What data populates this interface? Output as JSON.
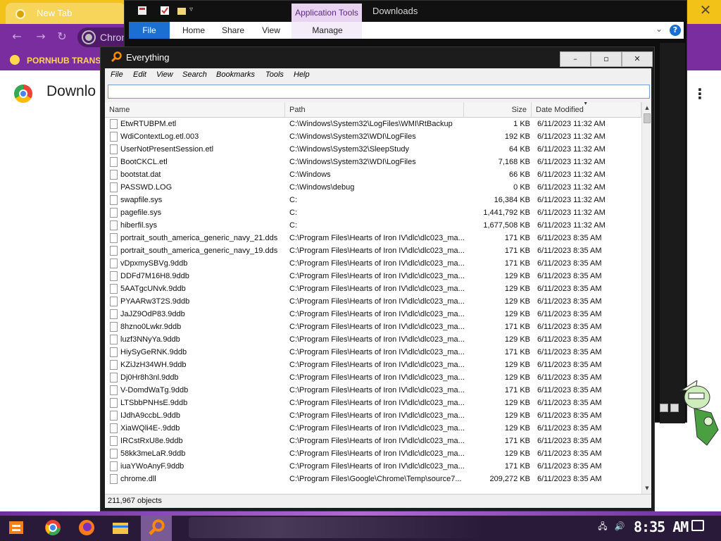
{
  "chrome": {
    "tab_title": "New Tab",
    "omnibox_text": "Chron",
    "bookmark_label": "PORNHUB TRANS",
    "page_title": "Downlo"
  },
  "explorer": {
    "context_tab": "Application Tools",
    "title": "Downloads",
    "ribbon_tabs": [
      "File",
      "Home",
      "Share",
      "View"
    ],
    "manage_tab": "Manage",
    "help_label": "?"
  },
  "everything": {
    "title": "Everything",
    "menu": [
      "File",
      "Edit",
      "View",
      "Search",
      "Bookmarks",
      "Tools",
      "Help"
    ],
    "search_value": "",
    "columns": {
      "name": "Name",
      "path": "Path",
      "size": "Size",
      "date": "Date Modified"
    },
    "rows": [
      {
        "name": "EtwRTUBPM.etl",
        "path": "C:\\Windows\\System32\\LogFiles\\WMI\\RtBackup",
        "size": "1 KB",
        "date": "6/11/2023 11:32 AM"
      },
      {
        "name": "WdiContextLog.etl.003",
        "path": "C:\\Windows\\System32\\WDI\\LogFiles",
        "size": "192 KB",
        "date": "6/11/2023 11:32 AM"
      },
      {
        "name": "UserNotPresentSession.etl",
        "path": "C:\\Windows\\System32\\SleepStudy",
        "size": "64 KB",
        "date": "6/11/2023 11:32 AM"
      },
      {
        "name": "BootCKCL.etl",
        "path": "C:\\Windows\\System32\\WDI\\LogFiles",
        "size": "7,168 KB",
        "date": "6/11/2023 11:32 AM"
      },
      {
        "name": "bootstat.dat",
        "path": "C:\\Windows",
        "size": "66 KB",
        "date": "6/11/2023 11:32 AM"
      },
      {
        "name": "PASSWD.LOG",
        "path": "C:\\Windows\\debug",
        "size": "0 KB",
        "date": "6/11/2023 11:32 AM"
      },
      {
        "name": "swapfile.sys",
        "path": "C:",
        "size": "16,384 KB",
        "date": "6/11/2023 11:32 AM"
      },
      {
        "name": "pagefile.sys",
        "path": "C:",
        "size": "1,441,792 KB",
        "date": "6/11/2023 11:32 AM"
      },
      {
        "name": "hiberfil.sys",
        "path": "C:",
        "size": "1,677,508 KB",
        "date": "6/11/2023 11:32 AM"
      },
      {
        "name": "portrait_south_america_generic_navy_21.dds",
        "path": "C:\\Program Files\\Hearts of Iron IV\\dlc\\dlc023_ma...",
        "size": "171 KB",
        "date": "6/11/2023 8:35 AM"
      },
      {
        "name": "portrait_south_america_generic_navy_19.dds",
        "path": "C:\\Program Files\\Hearts of Iron IV\\dlc\\dlc023_ma...",
        "size": "171 KB",
        "date": "6/11/2023 8:35 AM"
      },
      {
        "name": "vDpxmySBVg.9ddb",
        "path": "C:\\Program Files\\Hearts of Iron IV\\dlc\\dlc023_ma...",
        "size": "171 KB",
        "date": "6/11/2023 8:35 AM"
      },
      {
        "name": "DDFd7M16H8.9ddb",
        "path": "C:\\Program Files\\Hearts of Iron IV\\dlc\\dlc023_ma...",
        "size": "129 KB",
        "date": "6/11/2023 8:35 AM"
      },
      {
        "name": "5AATgcUNvk.9ddb",
        "path": "C:\\Program Files\\Hearts of Iron IV\\dlc\\dlc023_ma...",
        "size": "129 KB",
        "date": "6/11/2023 8:35 AM"
      },
      {
        "name": "PYAARw3T2S.9ddb",
        "path": "C:\\Program Files\\Hearts of Iron IV\\dlc\\dlc023_ma...",
        "size": "129 KB",
        "date": "6/11/2023 8:35 AM"
      },
      {
        "name": "JaJZ9OdP83.9ddb",
        "path": "C:\\Program Files\\Hearts of Iron IV\\dlc\\dlc023_ma...",
        "size": "129 KB",
        "date": "6/11/2023 8:35 AM"
      },
      {
        "name": "8hzno0Lwkr.9ddb",
        "path": "C:\\Program Files\\Hearts of Iron IV\\dlc\\dlc023_ma...",
        "size": "171 KB",
        "date": "6/11/2023 8:35 AM"
      },
      {
        "name": "luzf3NNyYa.9ddb",
        "path": "C:\\Program Files\\Hearts of Iron IV\\dlc\\dlc023_ma...",
        "size": "129 KB",
        "date": "6/11/2023 8:35 AM"
      },
      {
        "name": "HiySyGeRNK.9ddb",
        "path": "C:\\Program Files\\Hearts of Iron IV\\dlc\\dlc023_ma...",
        "size": "171 KB",
        "date": "6/11/2023 8:35 AM"
      },
      {
        "name": "KZiJzH34WH.9ddb",
        "path": "C:\\Program Files\\Hearts of Iron IV\\dlc\\dlc023_ma...",
        "size": "129 KB",
        "date": "6/11/2023 8:35 AM"
      },
      {
        "name": "Dj0Hr8h3nl.9ddb",
        "path": "C:\\Program Files\\Hearts of Iron IV\\dlc\\dlc023_ma...",
        "size": "129 KB",
        "date": "6/11/2023 8:35 AM"
      },
      {
        "name": "V-DomdWaTg.9ddb",
        "path": "C:\\Program Files\\Hearts of Iron IV\\dlc\\dlc023_ma...",
        "size": "171 KB",
        "date": "6/11/2023 8:35 AM"
      },
      {
        "name": "LTSbbPNHsE.9ddb",
        "path": "C:\\Program Files\\Hearts of Iron IV\\dlc\\dlc023_ma...",
        "size": "129 KB",
        "date": "6/11/2023 8:35 AM"
      },
      {
        "name": "IJdhA9ccbL.9ddb",
        "path": "C:\\Program Files\\Hearts of Iron IV\\dlc\\dlc023_ma...",
        "size": "129 KB",
        "date": "6/11/2023 8:35 AM"
      },
      {
        "name": "XiaWQli4E-.9ddb",
        "path": "C:\\Program Files\\Hearts of Iron IV\\dlc\\dlc023_ma...",
        "size": "129 KB",
        "date": "6/11/2023 8:35 AM"
      },
      {
        "name": "IRCstRxU8e.9ddb",
        "path": "C:\\Program Files\\Hearts of Iron IV\\dlc\\dlc023_ma...",
        "size": "171 KB",
        "date": "6/11/2023 8:35 AM"
      },
      {
        "name": "58kk3meLaR.9ddb",
        "path": "C:\\Program Files\\Hearts of Iron IV\\dlc\\dlc023_ma...",
        "size": "129 KB",
        "date": "6/11/2023 8:35 AM"
      },
      {
        "name": "iuaYWoAnyF.9ddb",
        "path": "C:\\Program Files\\Hearts of Iron IV\\dlc\\dlc023_ma...",
        "size": "171 KB",
        "date": "6/11/2023 8:35 AM"
      },
      {
        "name": "chrome.dll",
        "path": "C:\\Program Files\\Google\\Chrome\\Temp\\source7...",
        "size": "209,272 KB",
        "date": "6/11/2023 8:35 AM"
      }
    ],
    "status": "211,967 objects"
  },
  "taskbar": {
    "clock": "8:35 AM"
  },
  "colors": {
    "chrome_tab_yellow": "#f3c218",
    "chrome_purple": "#7a2d9e",
    "explorer_file_blue": "#1a6fd0",
    "taskbar_dark": "#2a1a3a"
  }
}
